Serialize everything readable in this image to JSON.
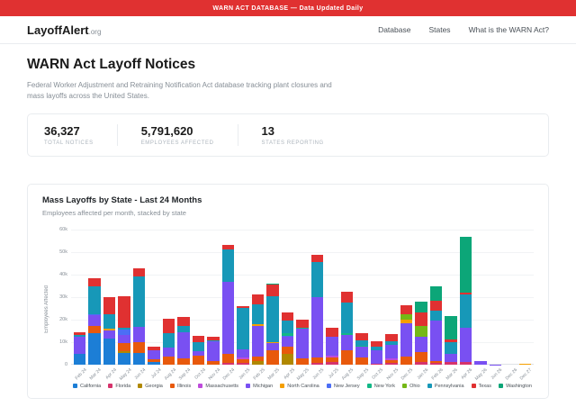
{
  "banner": {
    "text": "WARN ACT DATABASE — Data Updated Daily"
  },
  "header": {
    "logo": "LayoffAlert",
    "logo_suffix": ".org",
    "nav": [
      {
        "label": "Database"
      },
      {
        "label": "States"
      },
      {
        "label": "What is the WARN Act?"
      }
    ]
  },
  "hero": {
    "title": "WARN Act Layoff Notices",
    "description": "Federal Worker Adjustment and Retraining Notification Act database tracking plant closures and mass layoffs across the United States."
  },
  "stats": [
    {
      "value": "36,327",
      "label": "TOTAL NOTICES"
    },
    {
      "value": "5,791,620",
      "label": "EMPLOYEES AFFECTED"
    },
    {
      "value": "13",
      "label": "STATES REPORTING"
    }
  ],
  "chart": {
    "title": "Mass Layoffs by State - Last 24 Months",
    "subtitle": "Employees affected per month, stacked by state"
  },
  "chart_data": {
    "type": "bar",
    "stacked": true,
    "title": "Mass Layoffs by State - Last 24 Months",
    "xlabel": "",
    "ylabel": "Employees Affected",
    "ylim": [
      0,
      60000
    ],
    "yticks": [
      "0",
      "10k",
      "20k",
      "30k",
      "40k",
      "50k",
      "60k"
    ],
    "grid": true,
    "legend_position": "bottom",
    "categories": [
      "Feb 24",
      "Mar 24",
      "Apr 24",
      "May 24",
      "Jun 24",
      "Jul 24",
      "Aug 24",
      "Sep 24",
      "Oct 24",
      "Nov 24",
      "Dec 24",
      "Jan 25",
      "Feb 25",
      "Mar 25",
      "Apr 25",
      "May 25",
      "Jun 25",
      "Jul 25",
      "Aug 25",
      "Sep 25",
      "Oct 25",
      "Nov 25",
      "Dec 25",
      "Jan 26",
      "Feb 26",
      "Mar 26",
      "Apr 26",
      "May 26",
      "Jun 26",
      "Dec 26",
      "Dec 27"
    ],
    "series": [
      {
        "name": "California",
        "color": "#1c7ed6",
        "values": [
          4600,
          13900,
          11600,
          5200,
          5000,
          1000,
          0,
          0,
          0,
          0,
          0,
          0,
          0,
          0,
          0,
          0,
          0,
          0,
          0,
          0,
          0,
          0,
          0,
          0,
          0,
          0,
          0,
          0,
          0,
          0,
          0
        ]
      },
      {
        "name": "Florida",
        "color": "#d6336c",
        "values": [
          0,
          0,
          0,
          0,
          0,
          0,
          0,
          0,
          0,
          0,
          800,
          700,
          0,
          0,
          0,
          0,
          600,
          1100,
          0,
          0,
          500,
          800,
          0,
          1100,
          700,
          1200,
          1000,
          0,
          0,
          0,
          0
        ]
      },
      {
        "name": "Georgia",
        "color": "#b08800",
        "values": [
          0,
          0,
          0,
          600,
          0,
          0,
          0,
          0,
          0,
          0,
          0,
          0,
          1400,
          0,
          4600,
          0,
          0,
          0,
          0,
          0,
          0,
          0,
          0,
          0,
          0,
          0,
          0,
          0,
          0,
          0,
          0
        ]
      },
      {
        "name": "Illinois",
        "color": "#e8590c",
        "values": [
          0,
          3400,
          0,
          3700,
          5100,
          1200,
          3400,
          2600,
          4000,
          1400,
          4100,
          1500,
          2200,
          6300,
          3300,
          2900,
          2400,
          2100,
          6200,
          3300,
          0,
          1300,
          3600,
          4300,
          700,
          0,
          0,
          0,
          0,
          0,
          0
        ]
      },
      {
        "name": "Massachusetts",
        "color": "#be4bdb",
        "values": [
          0,
          0,
          0,
          0,
          0,
          0,
          0,
          0,
          0,
          0,
          0,
          900,
          0,
          0,
          0,
          0,
          0,
          700,
          0,
          0,
          0,
          600,
          0,
          0,
          0,
          0,
          0,
          0,
          0,
          0,
          0
        ]
      },
      {
        "name": "Michigan",
        "color": "#7950f2",
        "values": [
          7900,
          4600,
          3500,
          3800,
          6800,
          4200,
          4100,
          11900,
          2100,
          8900,
          32000,
          3500,
          13600,
          3100,
          4300,
          12900,
          26900,
          8500,
          6900,
          4600,
          5700,
          6200,
          14600,
          7100,
          18100,
          3600,
          15200,
          1600,
          100,
          0,
          0
        ]
      },
      {
        "name": "North Carolina",
        "color": "#f59f00",
        "values": [
          0,
          0,
          700,
          0,
          0,
          0,
          0,
          0,
          0,
          0,
          0,
          0,
          600,
          500,
          0,
          0,
          0,
          0,
          0,
          0,
          0,
          0,
          1600,
          0,
          0,
          0,
          0,
          0,
          0,
          0,
          300
        ]
      },
      {
        "name": "New Jersey",
        "color": "#4c6ef5",
        "values": [
          0,
          600,
          0,
          2400,
          0,
          0,
          0,
          0,
          0,
          0,
          0,
          0,
          0,
          0,
          700,
          0,
          0,
          0,
          0,
          0,
          0,
          0,
          0,
          0,
          0,
          0,
          0,
          0,
          0,
          0,
          0
        ]
      },
      {
        "name": "New York",
        "color": "#12b886",
        "values": [
          0,
          0,
          0,
          0,
          0,
          0,
          0,
          0,
          0,
          0,
          0,
          0,
          0,
          0,
          1100,
          600,
          0,
          0,
          700,
          600,
          0,
          0,
          0,
          0,
          0,
          0,
          0,
          0,
          0,
          0,
          0
        ]
      },
      {
        "name": "Ohio",
        "color": "#74b816",
        "values": [
          0,
          0,
          0,
          0,
          0,
          0,
          0,
          0,
          0,
          0,
          0,
          0,
          0,
          0,
          0,
          0,
          0,
          0,
          0,
          0,
          0,
          0,
          2500,
          4800,
          0,
          0,
          0,
          0,
          0,
          0,
          0
        ]
      },
      {
        "name": "Pennsylvania",
        "color": "#1798b8",
        "values": [
          600,
          12100,
          6400,
          500,
          22200,
          0,
          6600,
          2700,
          4000,
          400,
          14100,
          18600,
          8900,
          20300,
          5400,
          0,
          15700,
          0,
          13800,
          2100,
          1700,
          1400,
          0,
          0,
          4500,
          5200,
          15100,
          0,
          0,
          0,
          0
        ]
      },
      {
        "name": "Texas",
        "color": "#e03131",
        "values": [
          1100,
          3900,
          7800,
          14200,
          3500,
          1600,
          6300,
          3800,
          2500,
          1500,
          2200,
          900,
          4500,
          5400,
          3600,
          3700,
          3200,
          4000,
          4800,
          3500,
          2500,
          3400,
          3900,
          5900,
          4500,
          1100,
          600,
          0,
          0,
          0,
          0
        ]
      },
      {
        "name": "Washington",
        "color": "#0ca678",
        "values": [
          0,
          0,
          0,
          0,
          0,
          0,
          0,
          0,
          0,
          0,
          0,
          0,
          0,
          500,
          0,
          0,
          0,
          0,
          0,
          0,
          0,
          0,
          0,
          4900,
          6100,
          10600,
          24700,
          0,
          0,
          0,
          0
        ]
      }
    ]
  }
}
